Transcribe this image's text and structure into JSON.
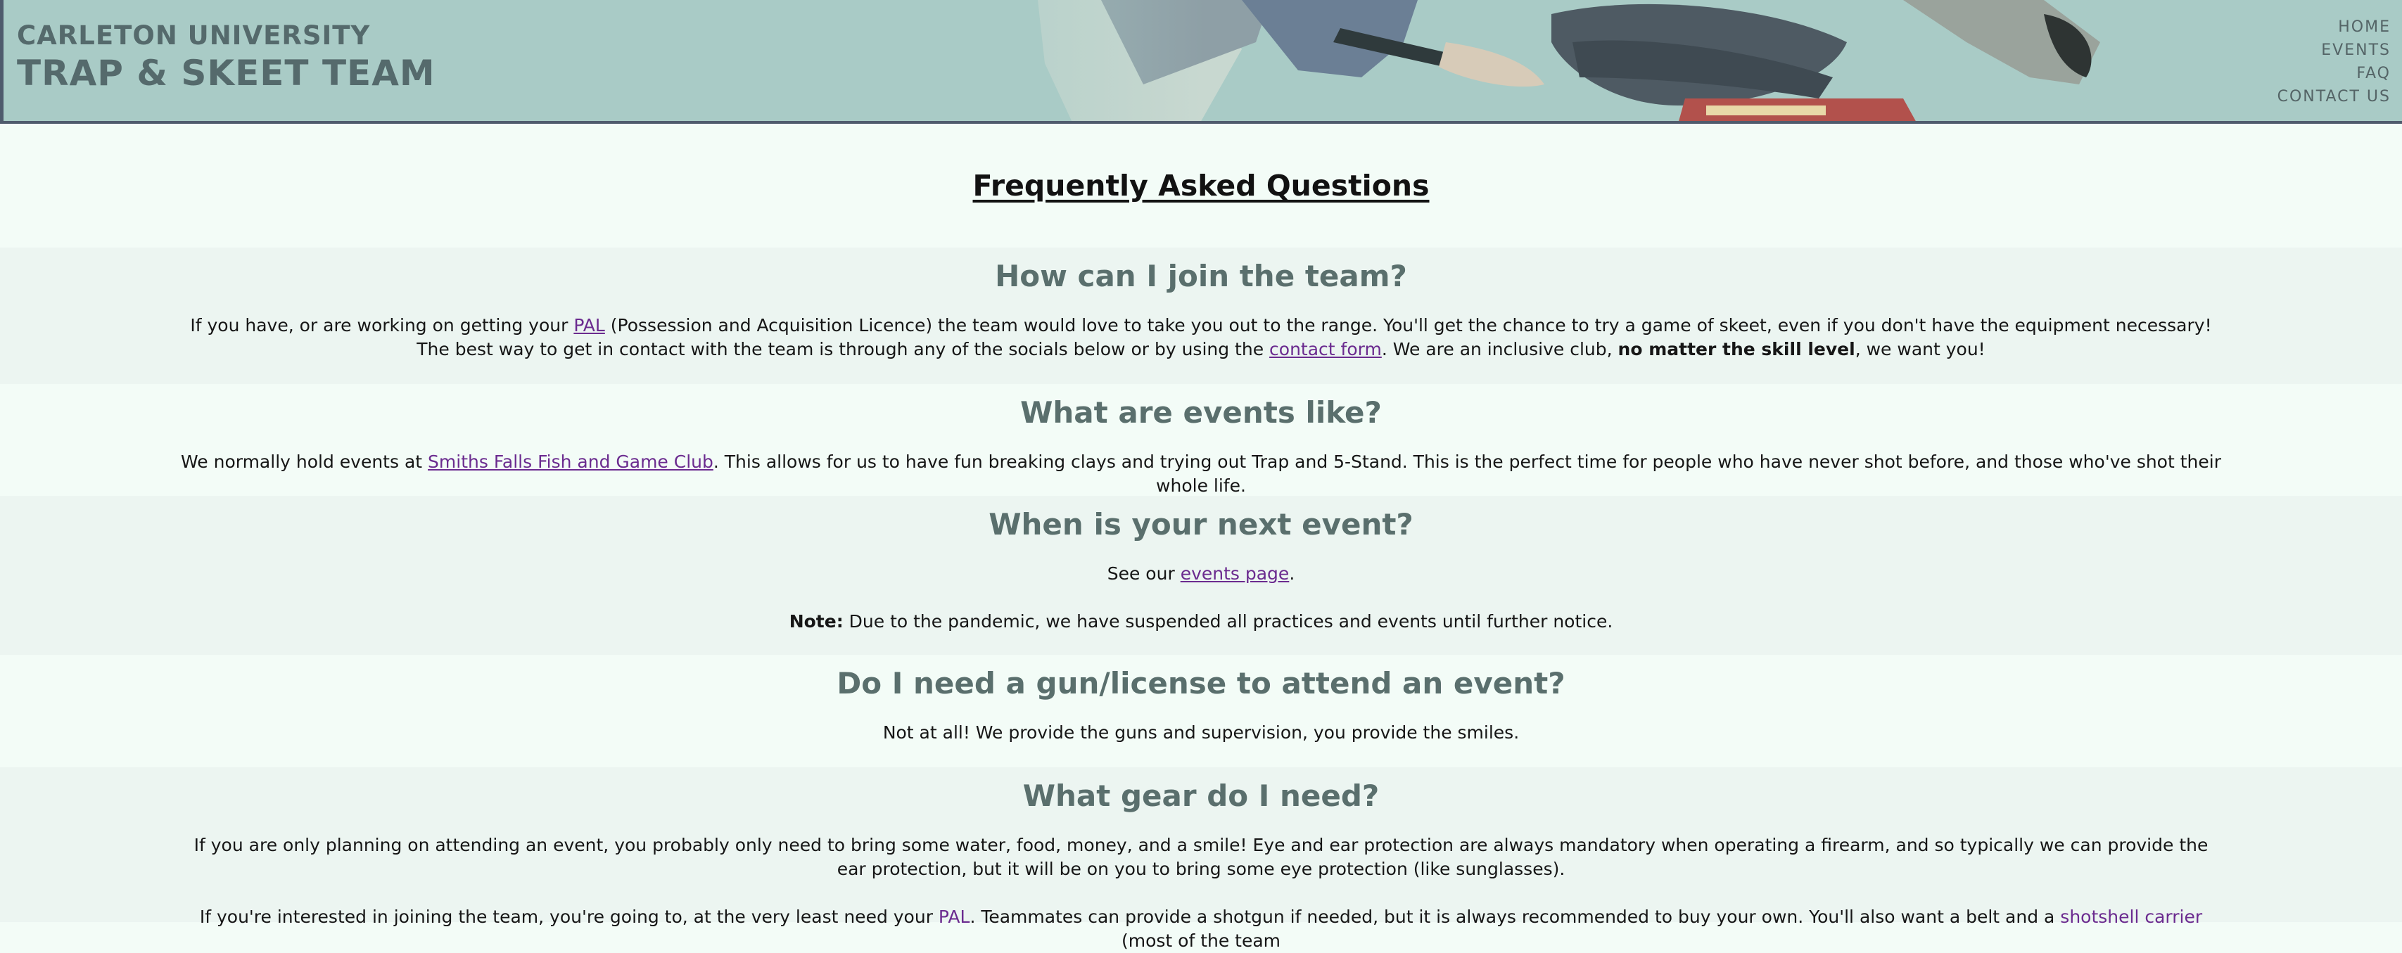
{
  "header": {
    "title_line1": "Carleton University",
    "title_line2": "Trap & Skeet Team"
  },
  "nav": {
    "items": [
      "HOME",
      "EVENTS",
      "FAQ",
      "CONTACT US"
    ]
  },
  "page_title": "Frequently Asked Questions",
  "faq": [
    {
      "question": "How can I join the team?",
      "p1_a": "If you have, or are working on getting your ",
      "p1_link1": "PAL",
      "p1_b": " (Possession and Acquisition Licence) the team would love to take you out to the range. You'll get the chance to try a game of skeet, even if you don't have the equipment necessary! The best way to get in contact with the team is through any of the socials below or by using the ",
      "p1_link2": "contact form",
      "p1_c": ". We are an inclusive club, ",
      "p1_bold": "no matter the skill level",
      "p1_d": ", we want you!"
    },
    {
      "question": "What are events like?",
      "p1_a": "We normally hold events at ",
      "p1_link1": "Smiths Falls Fish and Game Club",
      "p1_b": ". This allows for us to have fun breaking clays and trying out Trap and 5-Stand. This is the perfect time for people who have never shot before, and those who've shot their whole life."
    },
    {
      "question": "When is your next event?",
      "p1_a": "See our ",
      "p1_link1": "events page",
      "p1_b": ".",
      "p2_bold": "Note:",
      "p2_text": " Due to the pandemic, we have suspended all practices and events until further notice."
    },
    {
      "question": "Do I need a gun/license to attend an event?",
      "p1_a": "Not at all! We provide the guns and supervision, you provide the smiles."
    },
    {
      "question": "What gear do I need?",
      "p1_a": "If you are only planning on attending an event, you probably only need to bring some water, food, money, and a smile! Eye and ear protection are always mandatory when operating a firearm, and so typically we can provide the ear protection, but it will be on you to bring some eye protection (like sunglasses).",
      "p2_a": "If you're interested in joining the team, you're going to, at the very least need your ",
      "p2_link1": "PAL",
      "p2_b": ". Teammates can provide a shotgun if needed, but it is always recommended to buy your own. You'll also want a belt and a ",
      "p2_link2": "shotshell carrier",
      "p2_c": " (most of the team"
    }
  ],
  "colors": {
    "header_bg": "#a9cbc6",
    "page_bg": "#f3fcf7",
    "alt_band": "#ecf5f1",
    "heading": "#5a6f6d",
    "link": "#6b2b8f"
  }
}
